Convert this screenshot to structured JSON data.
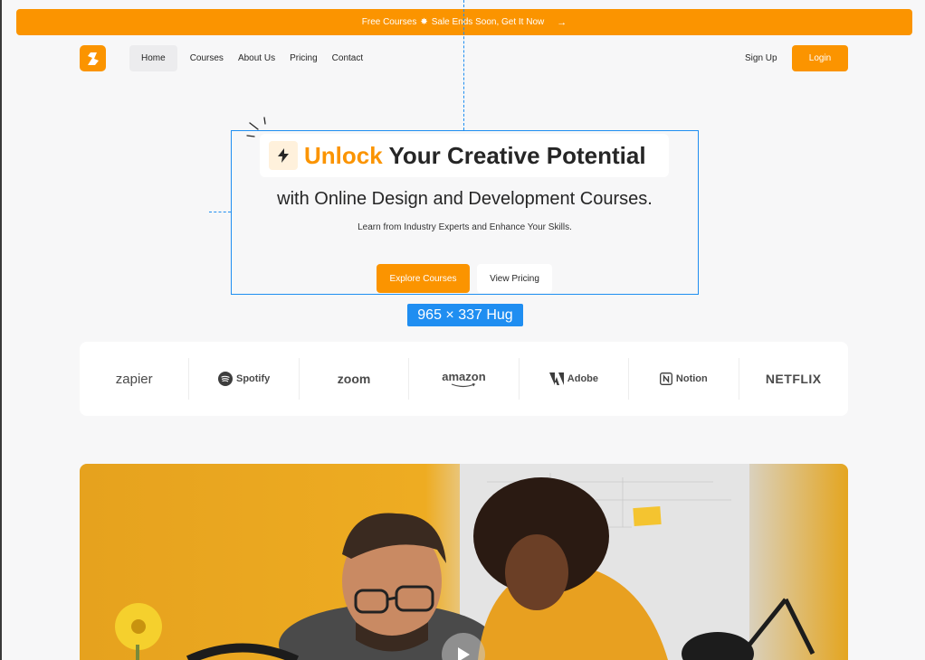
{
  "banner": {
    "text_before": "Free Courses",
    "star": "✸",
    "text_after": "Sale Ends Soon, Get It Now",
    "arrow": "→"
  },
  "nav": {
    "items": [
      {
        "label": "Home",
        "active": true
      },
      {
        "label": "Courses"
      },
      {
        "label": "About Us"
      },
      {
        "label": "Pricing"
      },
      {
        "label": "Contact"
      }
    ],
    "signup": "Sign Up",
    "login": "Login"
  },
  "hero": {
    "headline_accent": "Unlock",
    "headline_rest": " Your Creative Potential",
    "subheadline": "with Online Design and Development Courses.",
    "tagline": "Learn from Industry Experts and Enhance Your Skills.",
    "primary_cta": "Explore Courses",
    "secondary_cta": "View Pricing"
  },
  "design_tool": {
    "size_label": "965 × 337 Hug"
  },
  "partners": [
    "zapier",
    "Spotify",
    "zoom",
    "amazon",
    "Adobe",
    "Notion",
    "NETFLIX"
  ],
  "colors": {
    "accent": "#fb9400",
    "selection": "#1f8ef1",
    "background": "#f7f7f8"
  },
  "media": {
    "play_icon": "play-icon"
  }
}
